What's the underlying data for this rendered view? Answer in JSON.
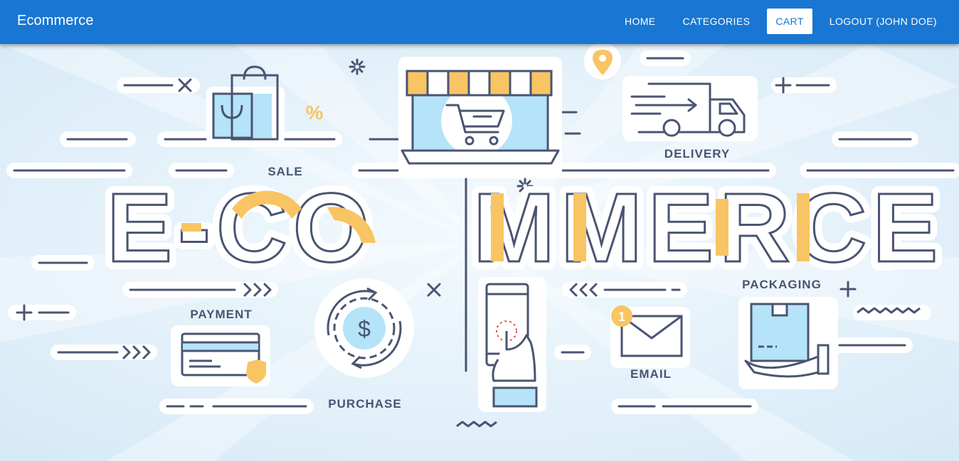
{
  "appbar": {
    "brand": "Ecommerce",
    "color": "#1976d2",
    "nav": {
      "home": "HOME",
      "categories": "CATEGORIES",
      "cart": "CART",
      "logout": "LOGOUT (JOHN DOE)"
    },
    "active_item": "CART"
  },
  "hero": {
    "title_left": "E-CO",
    "title_right": "MMERCE",
    "labels": {
      "sale": "SALE",
      "delivery": "DELIVERY",
      "payment": "PAYMENT",
      "purchase": "PURCHASE",
      "email": "EMAIL",
      "packaging": "PACKAGING"
    },
    "email_badge": "1",
    "percent_symbol": "%",
    "dollar_symbol": "$",
    "colors": {
      "outline": "#4a5472",
      "accent_yellow": "#f9c463",
      "light_blue": "#b5e3f8",
      "background": "#e6f2fa"
    }
  }
}
